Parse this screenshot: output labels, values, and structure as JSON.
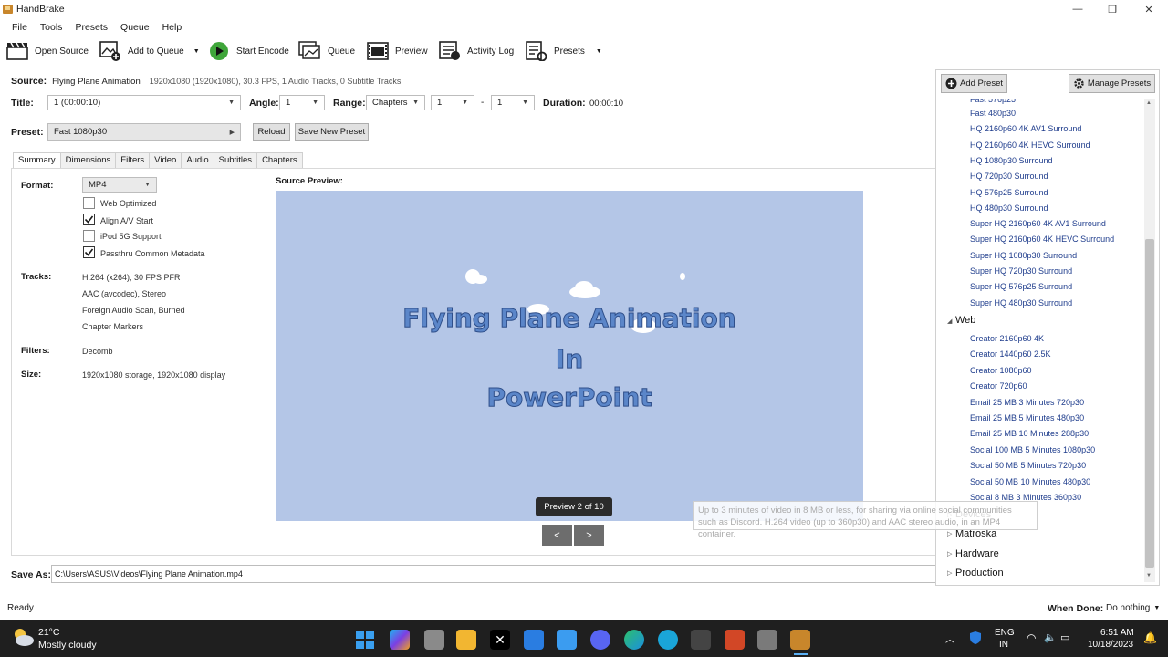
{
  "window": {
    "title": "HandBrake",
    "minimize": "—",
    "maximize": "❐",
    "close": "✕"
  },
  "menu": [
    "File",
    "Tools",
    "Presets",
    "Queue",
    "Help"
  ],
  "toolbar": {
    "open_source": "Open Source",
    "add_to_queue": "Add to Queue",
    "start_encode": "Start Encode",
    "queue": "Queue",
    "preview": "Preview",
    "activity_log": "Activity Log",
    "presets": "Presets"
  },
  "source": {
    "label": "Source:",
    "name": "Flying Plane Animation",
    "details": "1920x1080 (1920x1080), 30.3 FPS, 1 Audio Tracks, 0 Subtitle Tracks"
  },
  "title_row": {
    "title_label": "Title:",
    "title_value": "1  (00:00:10)",
    "angle_label": "Angle:",
    "angle_value": "1",
    "range_label": "Range:",
    "range_value": "Chapters",
    "range_from": "1",
    "range_dash": "-",
    "range_to": "1",
    "duration_label": "Duration:",
    "duration_value": "00:00:10"
  },
  "preset_row": {
    "label": "Preset:",
    "value": "Fast 1080p30",
    "reload": "Reload",
    "save_new": "Save New Preset"
  },
  "tabs": [
    "Summary",
    "Dimensions",
    "Filters",
    "Video",
    "Audio",
    "Subtitles",
    "Chapters"
  ],
  "summary": {
    "format_label": "Format:",
    "format_value": "MP4",
    "checkboxes": [
      {
        "label": "Web Optimized",
        "checked": false
      },
      {
        "label": "Align A/V Start",
        "checked": true
      },
      {
        "label": "iPod 5G Support",
        "checked": false
      },
      {
        "label": "Passthru Common Metadata",
        "checked": true
      }
    ],
    "tracks_label": "Tracks:",
    "tracks": [
      "H.264 (x264), 30 FPS PFR",
      "AAC (avcodec), Stereo",
      "Foreign Audio Scan, Burned",
      "Chapter Markers"
    ],
    "filters_label": "Filters:",
    "filters_value": "Decomb",
    "size_label": "Size:",
    "size_value": "1920x1080 storage, 1920x1080 display"
  },
  "preview": {
    "label": "Source Preview:",
    "lines": [
      "Flying Plane Animation",
      "In",
      "PowerPoint"
    ],
    "counter": "Preview 2 of 10",
    "prev": "<",
    "next": ">"
  },
  "presets_panel": {
    "add": "Add Preset",
    "manage": "Manage Presets",
    "partial": "Fast 576p25",
    "general_items": [
      "Fast 480p30",
      "HQ 2160p60 4K AV1 Surround",
      "HQ 2160p60 4K HEVC Surround",
      "HQ 1080p30 Surround",
      "HQ 720p30 Surround",
      "HQ 576p25 Surround",
      "HQ 480p30 Surround",
      "Super HQ 2160p60 4K AV1 Surround",
      "Super HQ 2160p60 4K HEVC Surround",
      "Super HQ 1080p30 Surround",
      "Super HQ 720p30 Surround",
      "Super HQ 576p25 Surround",
      "Super HQ 480p30 Surround"
    ],
    "web_group": "Web",
    "web_items": [
      "Creator 2160p60 4K",
      "Creator 1440p60 2.5K",
      "Creator 1080p60",
      "Creator 720p60",
      "Email 25 MB 3 Minutes 720p30",
      "Email 25 MB 5 Minutes 480p30",
      "Email 25 MB 10 Minutes 288p30",
      "Social 100 MB 5 Minutes 1080p30",
      "Social 50 MB 5 Minutes 720p30",
      "Social 50 MB 10 Minutes 480p30",
      "Social 8 MB 3 Minutes 360p30"
    ],
    "collapsed_groups": [
      "Devices",
      "Matroska",
      "Hardware",
      "Production"
    ],
    "tooltip": "Up to 3 minutes of video in 8 MB or less, for sharing via online social communities such as Discord. H.264 video (up to 360p30) and AAC stereo audio, in an MP4 container."
  },
  "save_as": {
    "label": "Save As:",
    "path": "C:\\Users\\ASUS\\Videos\\Flying Plane Animation.mp4"
  },
  "status": {
    "text": "Ready",
    "when_done_label": "When Done:",
    "when_done_value": "Do nothing"
  },
  "taskbar": {
    "temp": "21°C",
    "weather": "Mostly cloudy",
    "lang1": "ENG",
    "lang2": "IN",
    "time": "6:51 AM",
    "date": "10/18/2023"
  }
}
